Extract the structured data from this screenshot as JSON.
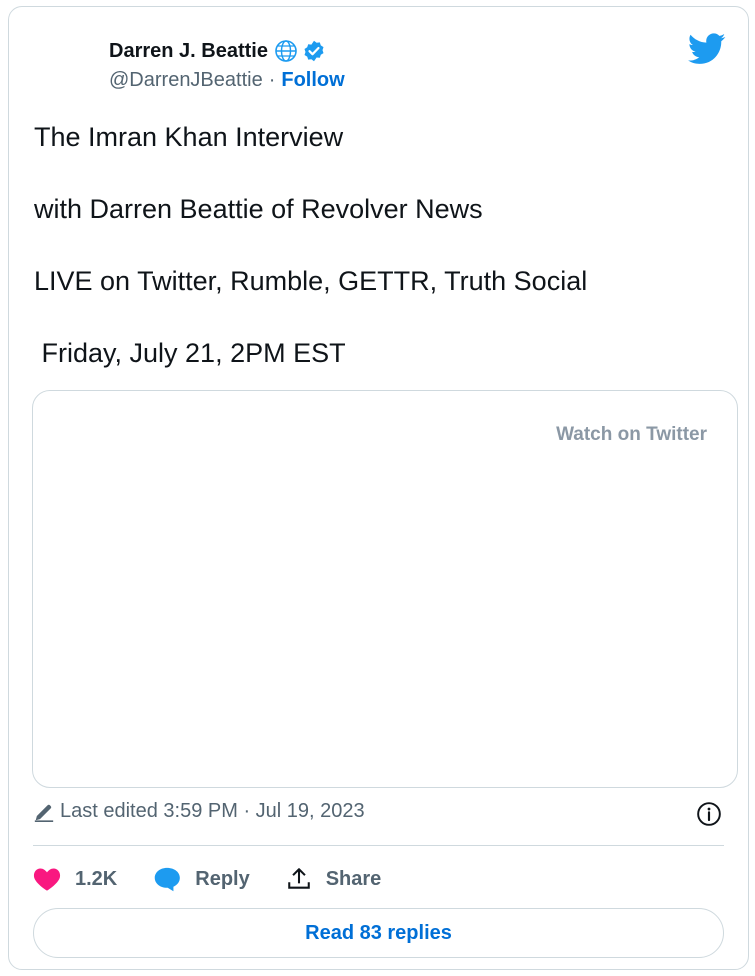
{
  "author": {
    "name": "Darren J. Beattie",
    "handle": "@DarrenJBeattie",
    "separator": "·",
    "follow_label": "Follow"
  },
  "icons": {
    "globe": "globe-icon",
    "verified": "verified-badge-icon",
    "logo": "twitter-bird-icon",
    "pencil": "pencil-icon",
    "info": "info-icon",
    "heart": "heart-icon",
    "reply": "reply-bubble-icon",
    "share": "share-icon"
  },
  "tweet": {
    "lines": [
      "The Imran Khan Interview",
      "with Darren Beattie of Revolver News",
      "LIVE on Twitter, Rumble, GETTR, Truth Social",
      " Friday, July 21, 2PM EST"
    ]
  },
  "media": {
    "watch_label": "Watch on Twitter"
  },
  "meta": {
    "edited_text": "Last edited 3:59 PM · Jul 19, 2023"
  },
  "actions": {
    "likes_count": "1.2K",
    "reply_label": "Reply",
    "share_label": "Share"
  },
  "replies": {
    "read_label": "Read 83 replies"
  },
  "colors": {
    "brand_blue": "#1d9bf0",
    "link_blue": "#006fd6",
    "like_pink": "#f91880",
    "text_primary": "#0f1419",
    "text_secondary": "#536471",
    "border": "#cfd9de"
  }
}
